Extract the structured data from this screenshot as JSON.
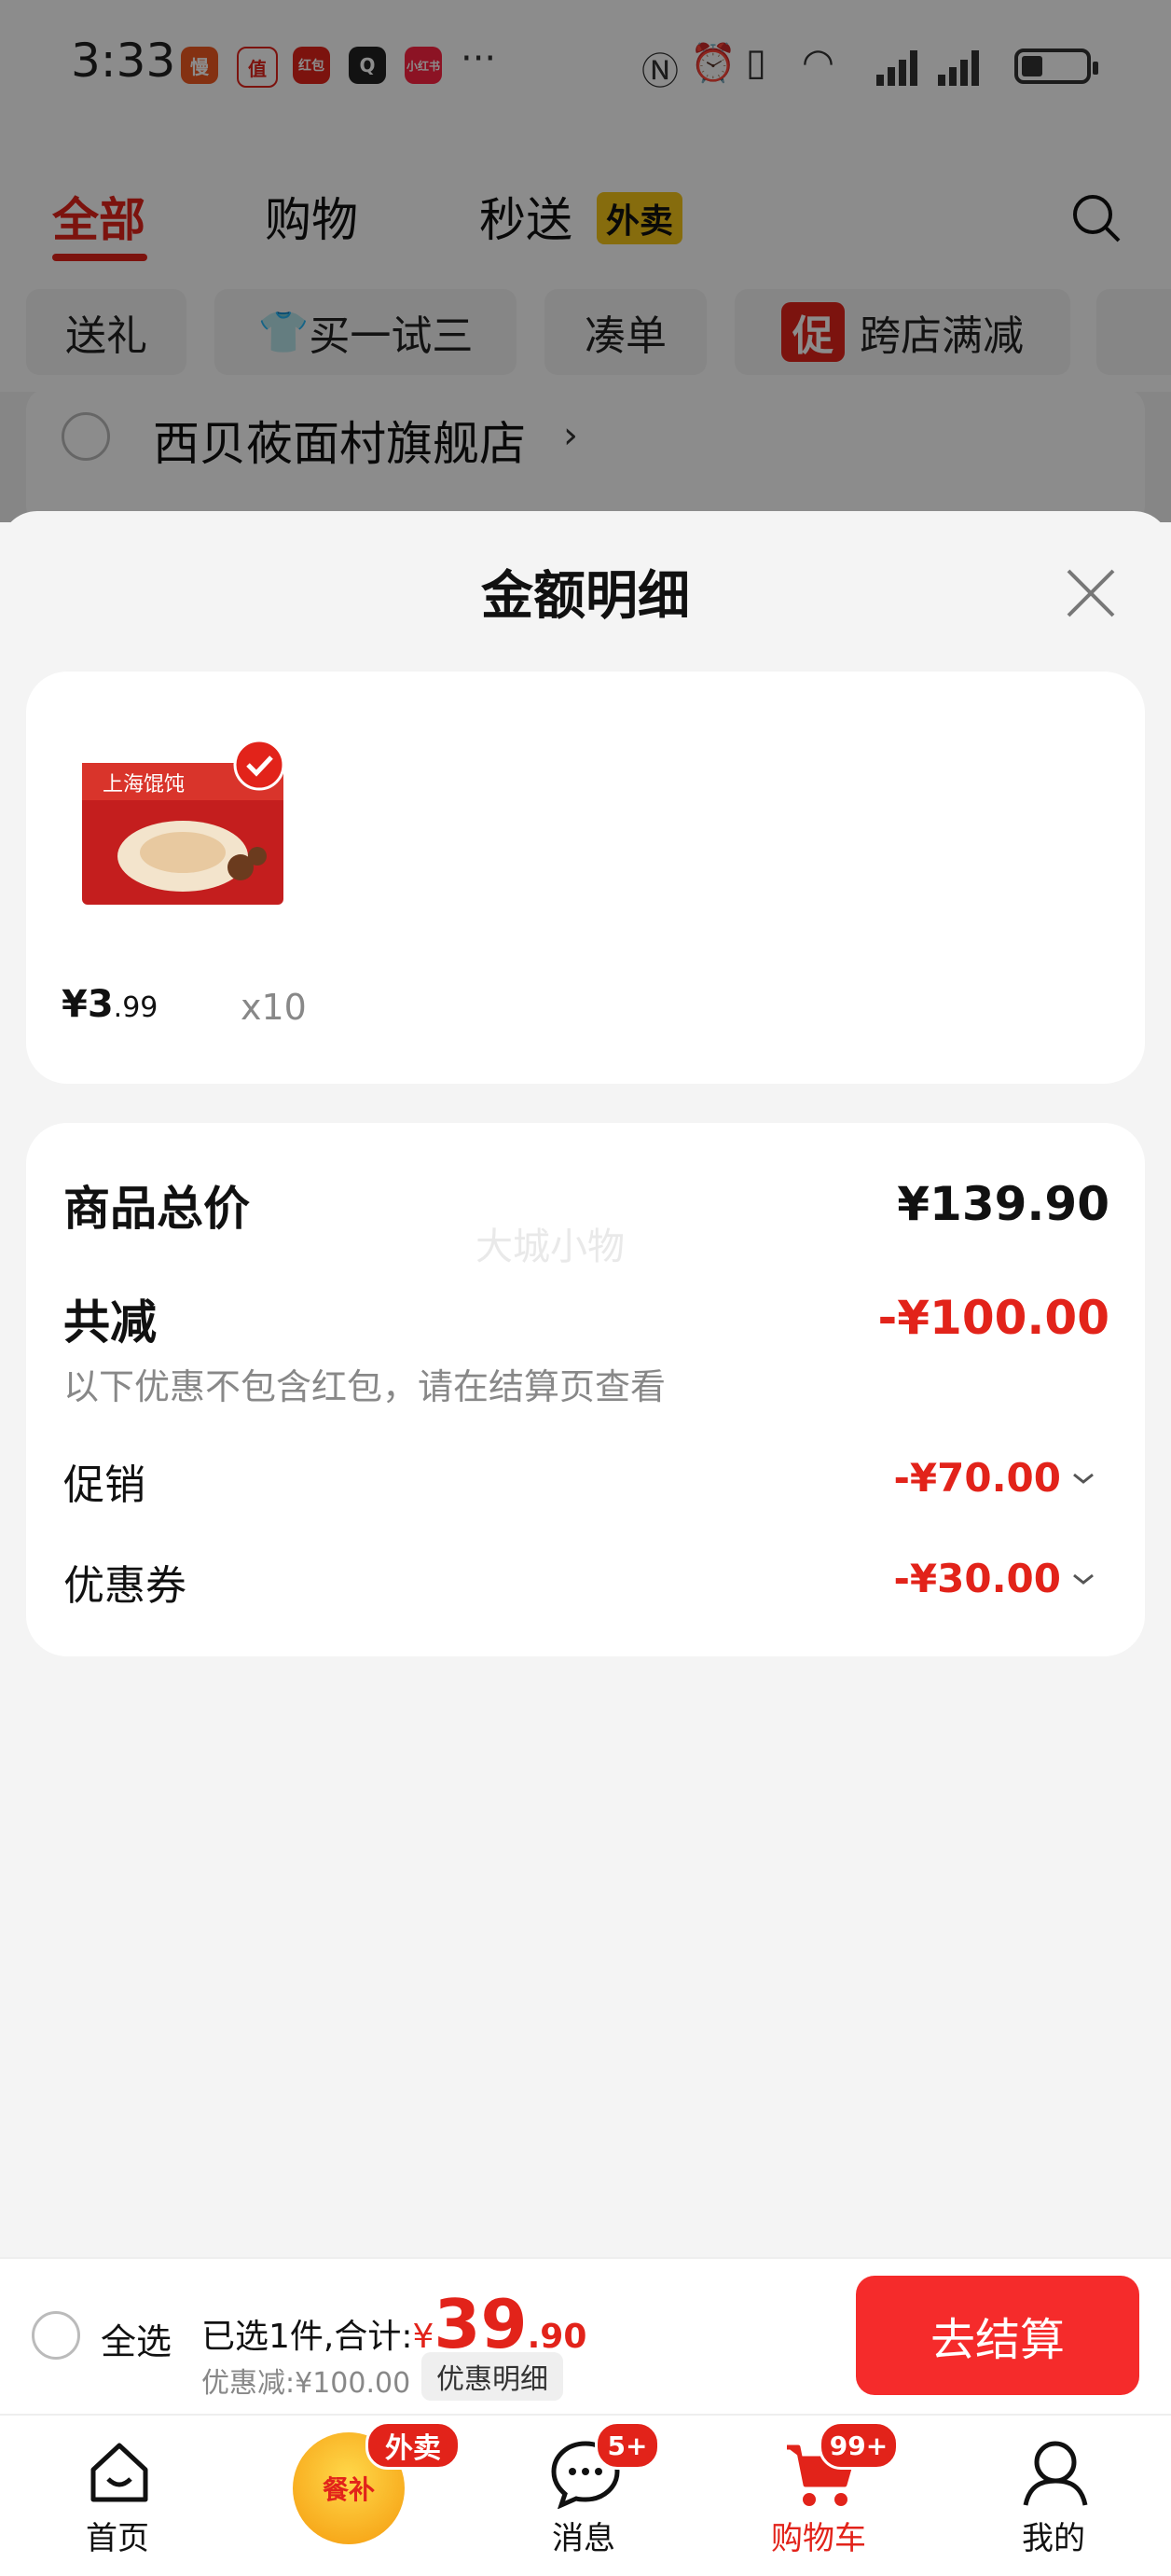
{
  "status_bar": {
    "time": "3:33",
    "apps": [
      "慢",
      "值",
      "红包",
      "Q",
      "小红书"
    ],
    "more": "···"
  },
  "tabs": [
    {
      "label": "全部"
    },
    {
      "label": "购物"
    },
    {
      "label": "秒送"
    }
  ],
  "tab_badge": "外卖",
  "filters": [
    "送礼",
    "买一试三",
    "凑单",
    "跨店满减"
  ],
  "promo_mark": "促",
  "store": {
    "name": "西贝莜面村旗舰店",
    "chevron": "›"
  },
  "modal": {
    "title": "金额明细",
    "product": {
      "price_main": "¥3",
      "price_decimal": ".99",
      "quantity": "x10",
      "image_text": "上海馄饨"
    },
    "summary": {
      "total_label": "商品总价",
      "total_value": "¥139.90",
      "discount_label": "共减",
      "discount_value": "-¥100.00",
      "note": "以下优惠不包含红包，请在结算页查看",
      "promo_label": "促销",
      "promo_value": "-¥70.00",
      "coupon_label": "优惠券",
      "coupon_value": "-¥30.00"
    },
    "watermark": "大城小物"
  },
  "checkout": {
    "select_all": "全选",
    "selected_text": "已选1件,合计:",
    "currency": "¥",
    "total_int": "39",
    "total_dec": ".90",
    "discount_text": "优惠减:¥100.00",
    "detail_button": "优惠明细",
    "pay_button": "去结算"
  },
  "nav": {
    "home": "首页",
    "meal_badge": "外卖",
    "meal_text": "餐补",
    "messages": "消息",
    "messages_badge": "5+",
    "cart": "购物车",
    "cart_badge": "99+",
    "mine": "我的"
  },
  "colors": {
    "accent": "#e2231a",
    "pay_button": "#f52b2b",
    "badge_yellow": "#f5c518"
  }
}
